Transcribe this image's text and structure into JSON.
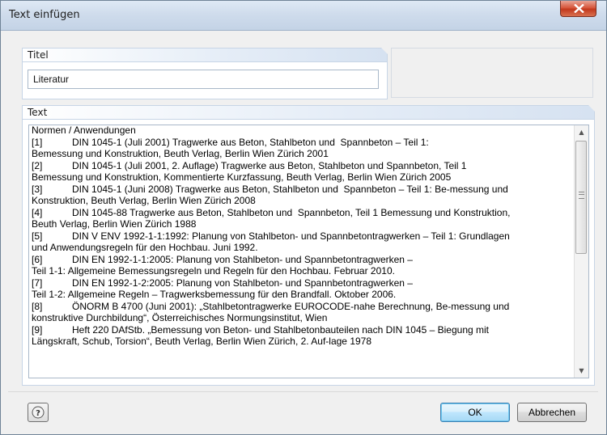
{
  "window": {
    "title": "Text einfügen"
  },
  "titel_section": {
    "header": "Titel",
    "value": "Literatur"
  },
  "text_section": {
    "header": "Text",
    "lines": [
      "Normen / Anwendungen",
      "[1]           DIN 1045-1 (Juli 2001) Tragwerke aus Beton, Stahlbeton und  Spannbeton – Teil 1:",
      "Bemessung und Konstruktion, Beuth Verlag, Berlin Wien Zürich 2001",
      "[2]           DIN 1045-1 (Juli 2001, 2. Auflage) Tragwerke aus Beton, Stahlbeton und Spannbeton, Teil 1",
      "Bemessung und Konstruktion, Kommentierte Kurzfassung, Beuth Verlag, Berlin Wien Zürich 2005",
      "[3]           DIN 1045-1 (Juni 2008) Tragwerke aus Beton, Stahlbeton und  Spannbeton – Teil 1: Be-messung und",
      "Konstruktion, Beuth Verlag, Berlin Wien Zürich 2008",
      "[4]           DIN 1045-88 Tragwerke aus Beton, Stahlbeton und  Spannbeton, Teil 1 Bemessung und Konstruktion,",
      "Beuth Verlag, Berlin Wien Zürich 1988",
      "[5]           DIN V ENV 1992-1-1:1992: Planung von Stahlbeton- und Spannbetontragwerken – Teil 1: Grundlagen",
      "und Anwendungsregeln für den Hochbau. Juni 1992.",
      "[6]           DIN EN 1992-1-1:2005: Planung von Stahlbeton- und Spannbetontragwerken –",
      "Teil 1-1: Allgemeine Bemessungsregeln und Regeln für den Hochbau. Februar 2010.",
      "[7]           DIN EN 1992-1-2:2005: Planung von Stahlbeton- und Spannbetontragwerken –",
      "Teil 1-2: Allgemeine Regeln – Tragwerksbemessung für den Brandfall. Oktober 2006.",
      "[8]           ÖNORM B 4700 (Juni 2001): „Stahlbetontragwerke EUROCODE-nahe Berechnung, Be-messung und",
      "konstruktive Durchbildung“, Österreichisches Normungsinstitut, Wien",
      "[9]           Heft 220 DAfStb. „Bemessung von Beton- und Stahlbetonbauteilen nach DIN 1045 – Biegung mit",
      "Längskraft, Schub, Torsion“, Beuth Verlag, Berlin Wien Zürich, 2. Auf-lage 1978"
    ]
  },
  "buttons": {
    "ok": "OK",
    "cancel": "Abbrechen"
  },
  "icons": {
    "close": "close-icon",
    "help": "help-icon",
    "scroll_up": "scroll-up-icon",
    "scroll_down": "scroll-down-icon"
  }
}
